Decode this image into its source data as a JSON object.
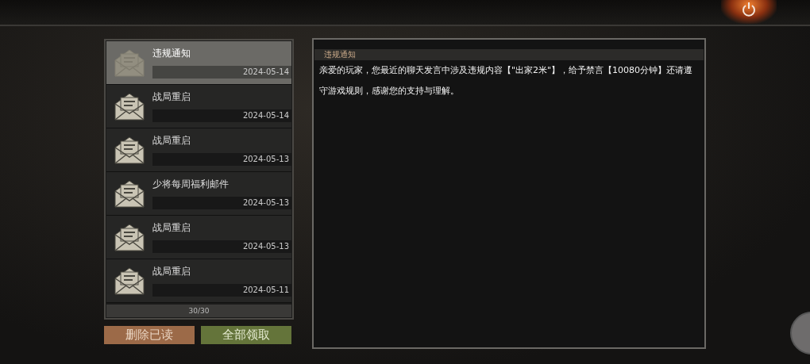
{
  "mails": [
    {
      "title": "违规通知",
      "date": "2024-05-14",
      "selected": true
    },
    {
      "title": "战局重启",
      "date": "2024-05-14",
      "selected": false
    },
    {
      "title": "战局重启",
      "date": "2024-05-13",
      "selected": false
    },
    {
      "title": "少将每周福利邮件",
      "date": "2024-05-13",
      "selected": false
    },
    {
      "title": "战局重启",
      "date": "2024-05-13",
      "selected": false
    },
    {
      "title": "战局重启",
      "date": "2024-05-11",
      "selected": false
    }
  ],
  "counter": "30/30",
  "buttons": [
    {
      "label": "删除已读",
      "kind": "delete"
    },
    {
      "label": "全部领取",
      "kind": "claim"
    }
  ],
  "detail": {
    "title": "违规通知",
    "body": "亲爱的玩家，您最近的聊天发言中涉及违规内容【\"出家2米\"】，给予禁言【10080分钟】还请遵守游戏规则，感谢您的支持与理解。"
  }
}
